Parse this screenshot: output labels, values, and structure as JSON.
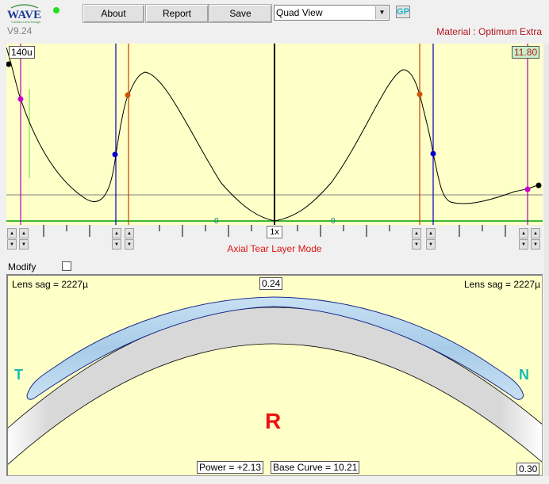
{
  "app": {
    "logo_text": "WAVE",
    "logo_subtext": "Contact Lens Design",
    "version": "V9.24",
    "status_color": "#22dd22"
  },
  "toolbar": {
    "about_label": "About",
    "report_label": "Report",
    "save_label": "Save",
    "view_select_value": "Quad View",
    "gp_label": "GP"
  },
  "material_label": "Material : Optimum Extra",
  "tear_chart": {
    "left_marker_value": "140u",
    "right_marker_value": "11.80",
    "zoom_value": "1x",
    "mode_label": "Axial Tear Layer Mode",
    "zero_labels": [
      "0",
      "0"
    ],
    "colors": {
      "curve": "#000000",
      "magenta": "#b000b0",
      "blue": "#0000b4",
      "orange": "#c04000",
      "green_axis": "#00a000",
      "gray_ref": "#808080",
      "background": "#ffffc8"
    }
  },
  "modify": {
    "label": "Modify",
    "checked": false
  },
  "lens_view": {
    "sag_left": "Lens sag = 2227µ",
    "sag_right": "Lens sag = 2227µ",
    "center_clearance": "0.24",
    "edge_clearance": "0.30",
    "power": "Power = +2.13",
    "base_curve": "Base Curve = 10.21",
    "temporal_label": "T",
    "nasal_label": "N",
    "eye_label": "R",
    "colors": {
      "lens_fill": "#a8cce8",
      "cornea_fill": "#d8d8d8",
      "side_label": "#1ab8b8",
      "eye_label": "#ee1111"
    }
  }
}
